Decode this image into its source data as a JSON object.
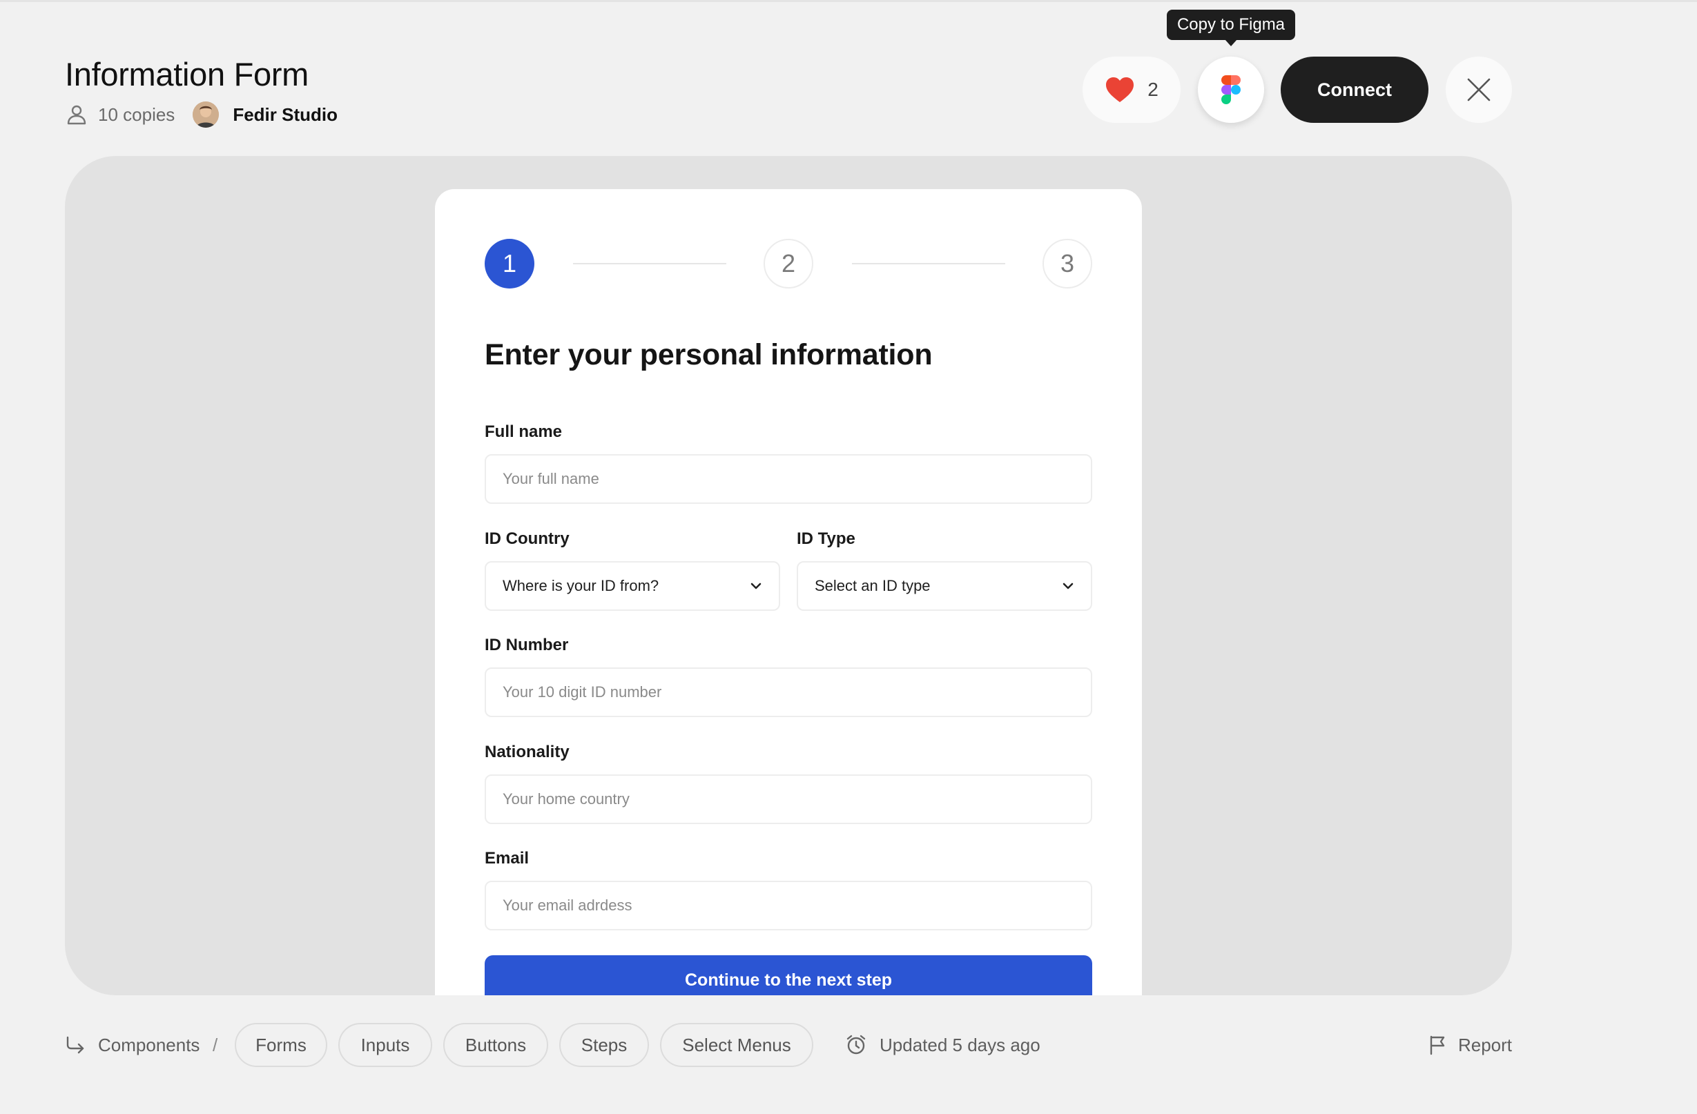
{
  "header": {
    "title": "Information Form",
    "copies": "10 copies",
    "author": "Fedir Studio",
    "likes": "2",
    "tooltip": "Copy to Figma",
    "connect_label": "Connect"
  },
  "form": {
    "steps": [
      "1",
      "2",
      "3"
    ],
    "active_step": 1,
    "heading": "Enter your personal information",
    "full_name": {
      "label": "Full name",
      "placeholder": "Your full name"
    },
    "id_country": {
      "label": "ID Country",
      "value": "Where is your ID from?"
    },
    "id_type": {
      "label": "ID Type",
      "value": "Select an ID type"
    },
    "id_number": {
      "label": "ID Number",
      "placeholder": "Your 10 digit ID number"
    },
    "nationality": {
      "label": "Nationality",
      "placeholder": "Your home country"
    },
    "email": {
      "label": "Email",
      "placeholder": "Your email adrdess"
    },
    "submit_label": "Continue to the next step"
  },
  "footer": {
    "breadcrumb_root": "Components",
    "separator": "/",
    "tags": [
      "Forms",
      "Inputs",
      "Buttons",
      "Steps",
      "Select Menus"
    ],
    "updated": "Updated 5 days ago",
    "report": "Report"
  },
  "colors": {
    "accent": "#2b55d3",
    "heart": "#ea4335",
    "dark_button": "#1f1f1f",
    "page_bg": "#f1f1f1",
    "stage_bg": "#e2e2e2"
  },
  "icons": [
    "person-icon",
    "heart-icon",
    "figma-icon",
    "close-icon",
    "chevron-down-icon",
    "breadcrumb-return-icon",
    "clock-icon",
    "flag-icon"
  ]
}
